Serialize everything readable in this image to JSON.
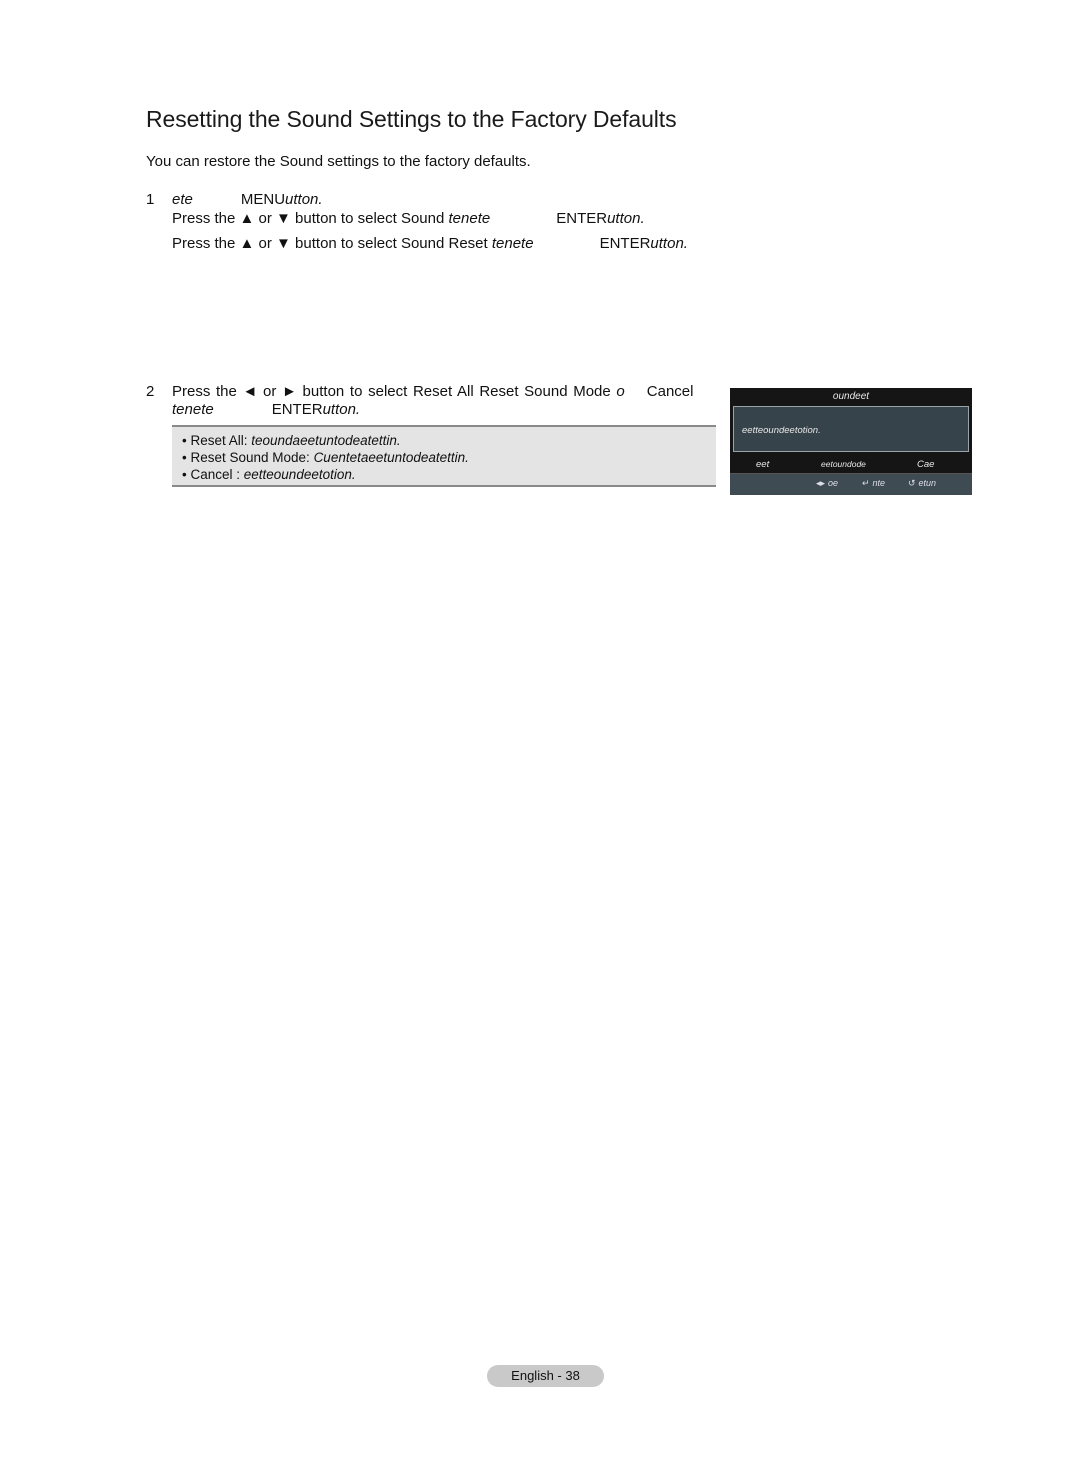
{
  "title": "Resetting the Sound Settings to the Factory Defaults",
  "intro": "You can restore the Sound settings to the factory defaults.",
  "step1": {
    "number": "1",
    "line1_a": "ete",
    "line1_b": "MENU",
    "line1_c": "utton.",
    "line2_a": "Press the ▲ or ▼ button to select Sound ",
    "line2_b": "tenete",
    "line2_c": "ENTER",
    "line2_d": "utton.",
    "line3_a": "Press the ▲ or ▼ button to select Sound Reset ",
    "line3_b": "tenete",
    "line3_c": "ENTER",
    "line3_d": "utton."
  },
  "step2": {
    "number": "2",
    "line1_a": "Press the ◄ or ► button to select Reset All   Reset Sound Mode ",
    "line1_b": "o",
    "line1_c": "Cancel",
    "line2_a": "tenete",
    "line2_b": "ENTER",
    "line2_c": "utton."
  },
  "notes": [
    {
      "label": "• Reset All: ",
      "desc": "teoundaeetuntodeatettin."
    },
    {
      "label": "• Reset Sound Mode:  ",
      "desc": "Cuentetaeetuntodeatettin."
    },
    {
      "label": "• Cancel :  ",
      "desc": "eetteoundeetotion."
    }
  ],
  "osd": {
    "title": "oundeet",
    "message": "eetteoundeetotion.",
    "options": [
      "eet",
      "eetoundode",
      "Cae"
    ],
    "hints": [
      {
        "icon": "left-right-arrows-icon",
        "glyph": "◂▸",
        "label": "oe"
      },
      {
        "icon": "enter-icon",
        "glyph": "↵",
        "label": "nte"
      },
      {
        "icon": "return-icon",
        "glyph": "↺",
        "label": "etun"
      }
    ]
  },
  "footer": {
    "page_label": "English - 38"
  }
}
